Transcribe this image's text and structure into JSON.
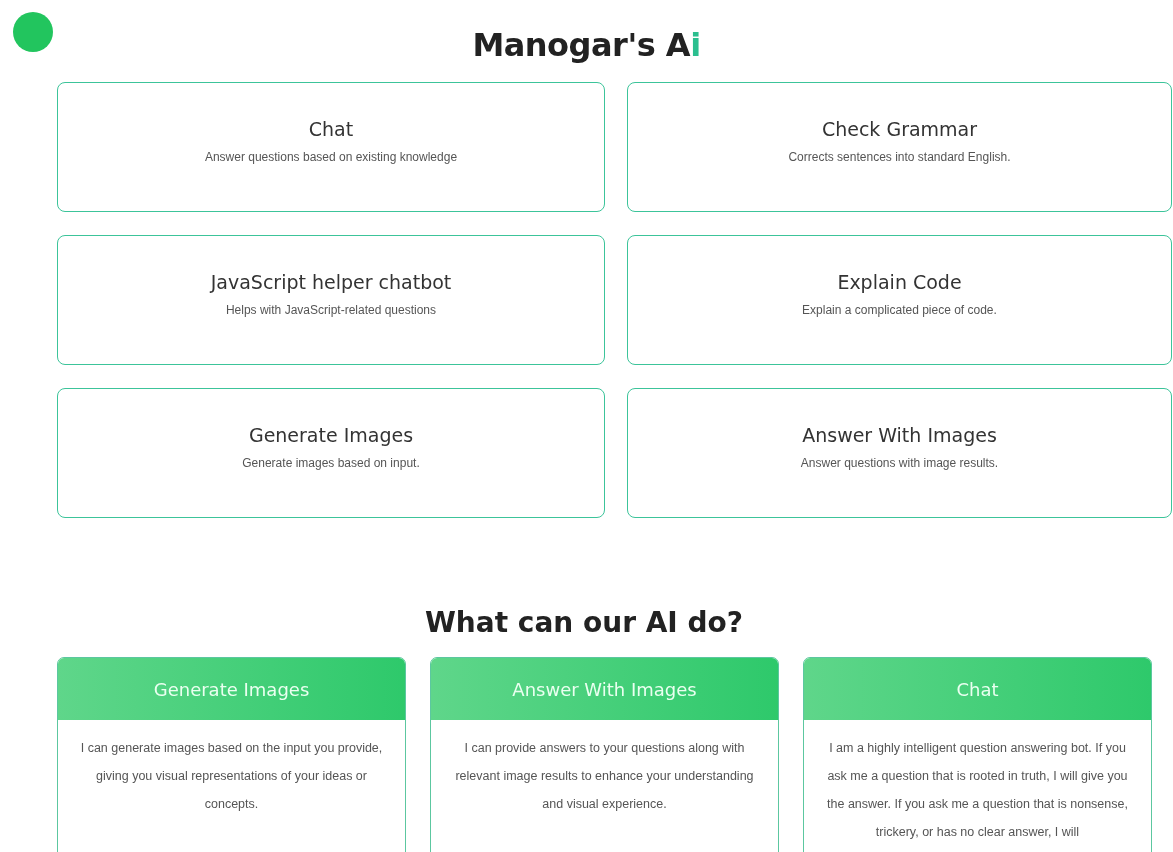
{
  "title": {
    "text": "Manogar's A",
    "accent": "i"
  },
  "tools": [
    {
      "name": "Chat",
      "description": "Answer questions based on existing knowledge"
    },
    {
      "name": "Check Grammar",
      "description": "Corrects sentences into standard English."
    },
    {
      "name": "JavaScript helper chatbot",
      "description": "Helps with JavaScript-related questions"
    },
    {
      "name": "Explain Code",
      "description": "Explain a complicated piece of code."
    },
    {
      "name": "Generate Images",
      "description": "Generate images based on input."
    },
    {
      "name": "Answer With Images",
      "description": "Answer questions with image results."
    }
  ],
  "section_heading": "What can our AI do?",
  "features": [
    {
      "title": "Generate Images",
      "text": "I can generate images based on the input you provide, giving you visual representations of your ideas or concepts."
    },
    {
      "title": "Answer With Images",
      "text": "I can provide answers to your questions along with relevant image results to enhance your understanding and visual experience."
    },
    {
      "title": "Chat",
      "text": "I am a highly intelligent question answering bot. If you ask me a question that is rooted in truth, I will give you the answer. If you ask me a question that is nonsense, trickery, or has no clear answer, I will"
    }
  ]
}
